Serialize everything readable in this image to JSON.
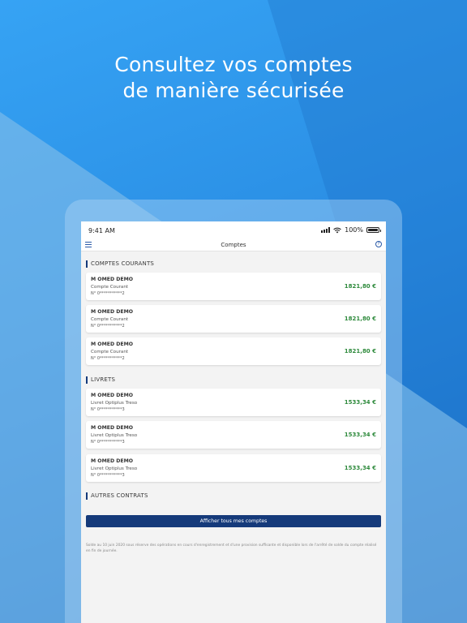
{
  "headline": {
    "line1": "Consultez vos comptes",
    "line2": "de manière sécurisée"
  },
  "colors": {
    "background": "#2d8fe3",
    "primary": "#153a7a",
    "amount": "#2e8a3c"
  },
  "status_bar": {
    "time": "9:41 AM",
    "battery": "100%",
    "icons": [
      "signal-icon",
      "wifi-icon",
      "battery-icon"
    ]
  },
  "nav": {
    "title": "Comptes",
    "menu_icon": "hamburger-menu-icon",
    "help_icon": "help-icon",
    "help_glyph": "?"
  },
  "sections": [
    {
      "title": "COMPTES COURANTS",
      "accounts": [
        {
          "holder": "M OMED DEMO",
          "type": "Compte Courant",
          "number": "N° 0***********2",
          "amount": "1821,80 €"
        },
        {
          "holder": "M OMED DEMO",
          "type": "Compte Courant",
          "number": "N° 0***********2",
          "amount": "1821,80 €"
        },
        {
          "holder": "M OMED DEMO",
          "type": "Compte Courant",
          "number": "N° 0***********2",
          "amount": "1821,80 €"
        }
      ]
    },
    {
      "title": "LIVRETS",
      "accounts": [
        {
          "holder": "M OMED DEMO",
          "type": "Livret Optiplus Treso",
          "number": "N° 0***********3",
          "amount": "1533,34 €"
        },
        {
          "holder": "M OMED DEMO",
          "type": "Livret Optiplus Treso",
          "number": "N° 0***********3",
          "amount": "1533,34 €"
        },
        {
          "holder": "M OMED DEMO",
          "type": "Livret Optiplus Treso",
          "number": "N° 0***********3",
          "amount": "1533,34 €"
        }
      ]
    },
    {
      "title": "AUTRES CONTRATS",
      "accounts": []
    }
  ],
  "cta_label": "Afficher tous mes comptes",
  "footnote": "Solde au 10 juin 2020 sous réserve des opérations en cours d'enregistrement et d'une provision suffisante et disponible lors de l'arrêté de solde du compte réalisé en fin de journée."
}
